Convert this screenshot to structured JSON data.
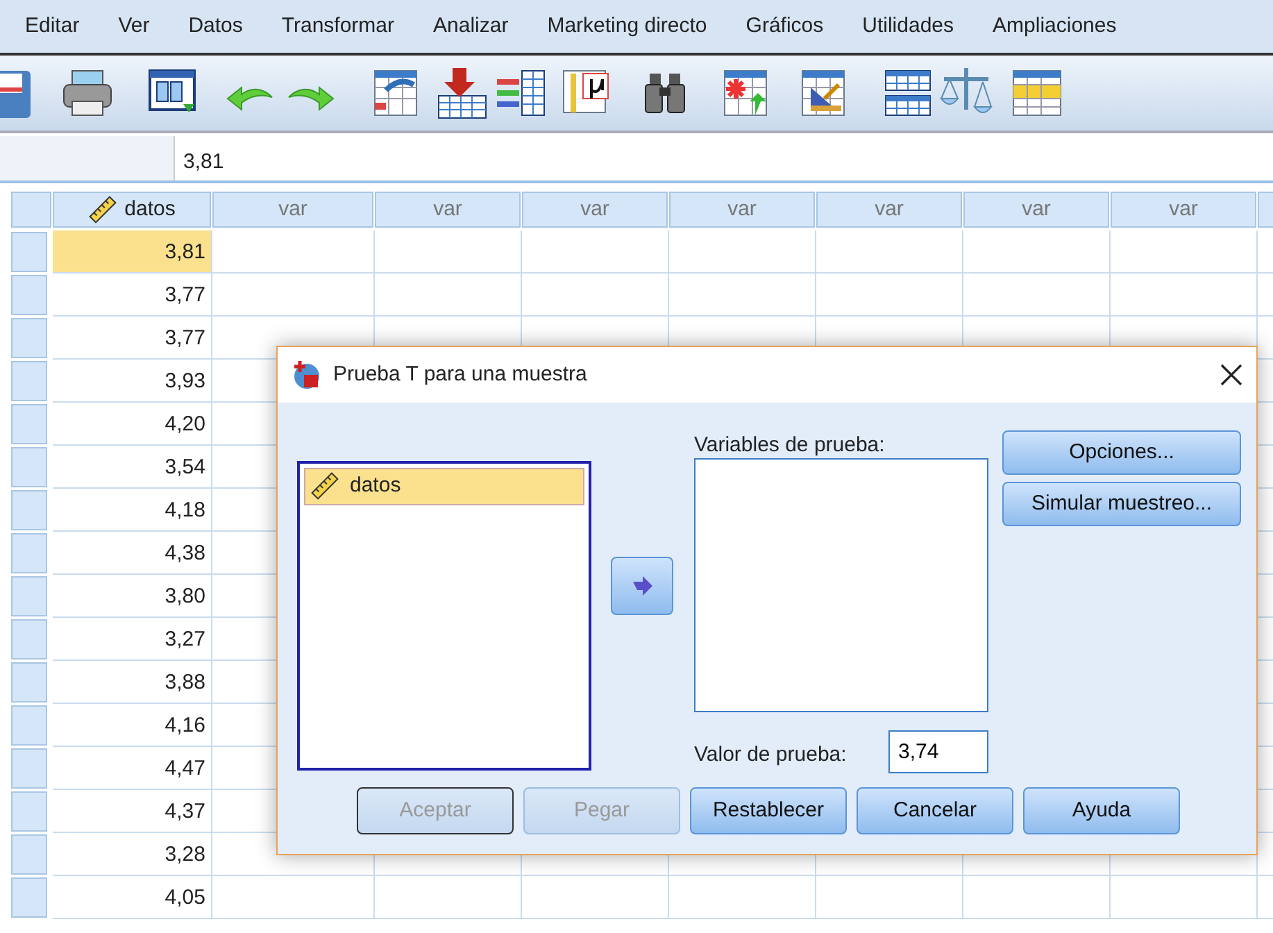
{
  "menu": [
    {
      "label": "Editar"
    },
    {
      "label": "Ver"
    },
    {
      "label": "Datos"
    },
    {
      "label": "Transformar"
    },
    {
      "label": "Analizar"
    },
    {
      "label": "Marketing directo"
    },
    {
      "label": "Gráficos"
    },
    {
      "label": "Utilidades"
    },
    {
      "label": "Ampliaciones"
    }
  ],
  "cell_editor": {
    "value": "3,81"
  },
  "grid": {
    "columns": [
      {
        "label": "datos",
        "kind": "scale"
      },
      {
        "label": "var",
        "kind": "empty"
      },
      {
        "label": "var",
        "kind": "empty"
      },
      {
        "label": "var",
        "kind": "empty"
      },
      {
        "label": "var",
        "kind": "empty"
      },
      {
        "label": "var",
        "kind": "empty"
      },
      {
        "label": "var",
        "kind": "empty"
      },
      {
        "label": "var",
        "kind": "empty"
      }
    ],
    "rows": [
      {
        "value": "3,81",
        "selected": true
      },
      {
        "value": "3,77",
        "selected": false
      },
      {
        "value": "3,77",
        "selected": false
      },
      {
        "value": "3,93",
        "selected": false
      },
      {
        "value": "4,20",
        "selected": false
      },
      {
        "value": "3,54",
        "selected": false
      },
      {
        "value": "4,18",
        "selected": false
      },
      {
        "value": "4,38",
        "selected": false
      },
      {
        "value": "3,80",
        "selected": false
      },
      {
        "value": "3,27",
        "selected": false
      },
      {
        "value": "3,88",
        "selected": false
      },
      {
        "value": "4,16",
        "selected": false
      },
      {
        "value": "4,47",
        "selected": false
      },
      {
        "value": "4,37",
        "selected": false
      },
      {
        "value": "3,28",
        "selected": false
      },
      {
        "value": "4,05",
        "selected": false
      }
    ]
  },
  "dialog": {
    "title": "Prueba T para una muestra",
    "source_list": [
      {
        "label": "datos",
        "selected": true
      }
    ],
    "test_variables_label": "Variables de prueba:",
    "test_value_label": "Valor de prueba:",
    "test_value": "3,74",
    "side_buttons": [
      {
        "label": "Opciones..."
      },
      {
        "label": "Simular muestreo..."
      }
    ],
    "buttons": [
      {
        "label": "Aceptar",
        "disabled": true,
        "default": true
      },
      {
        "label": "Pegar",
        "disabled": true,
        "default": false
      },
      {
        "label": "Restablecer",
        "disabled": false,
        "default": false
      },
      {
        "label": "Cancelar",
        "disabled": false,
        "default": false
      },
      {
        "label": "Ayuda",
        "disabled": false,
        "default": false
      }
    ]
  }
}
